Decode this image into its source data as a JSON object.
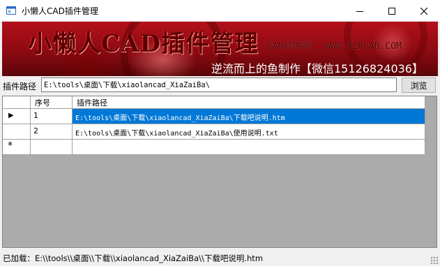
{
  "window": {
    "title": "小懒人CAD插件管理",
    "min_icon": "minimize-icon",
    "max_icon": "maximize-icon",
    "close_icon": "close-icon"
  },
  "banner": {
    "title": "小懒人CAD插件管理",
    "site": "CAD插件网： WWW.XLRCAD.COM",
    "credit": "逆流而上的鱼制作【微信15126824036】",
    "colors": {
      "background": "#a8101a",
      "title": "#5c0000",
      "credit": "#ffffff"
    }
  },
  "toolbar": {
    "path_label": "插件路径",
    "path_value": "E:\\tools\\桌面\\下载\\xiaolancad_XiaZaiBa\\",
    "browse_label": "浏览"
  },
  "grid": {
    "columns": [
      "序号",
      "插件路径"
    ],
    "rows": [
      {
        "marker": "▶",
        "seq": "1",
        "path": "E:\\tools\\桌面\\下载\\xiaolancad_XiaZaiBa\\下载吧说明.htm",
        "selected": true
      },
      {
        "marker": "",
        "seq": "2",
        "path": "E:\\tools\\桌面\\下载\\xiaolancad_XiaZaiBa\\使用说明.txt",
        "selected": false
      }
    ],
    "new_row_marker": "*",
    "colors": {
      "selection": "#0078d7",
      "empty_area": "#ababab"
    }
  },
  "status": {
    "text": "已加载：E:\\\\tools\\\\桌面\\\\下载\\\\xiaolancad_XiaZaiBa\\\\下载吧说明.htm"
  }
}
